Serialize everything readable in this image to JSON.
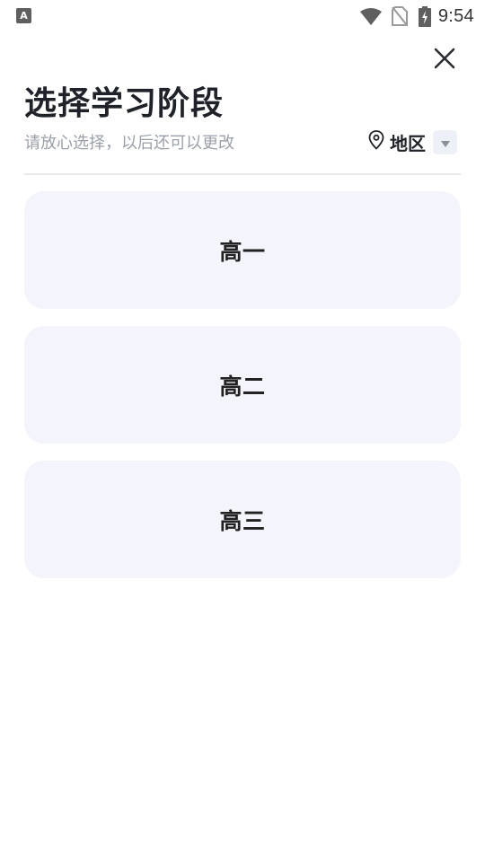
{
  "status_bar": {
    "app_icon_letter": "A",
    "time": "9:54",
    "icons": [
      "wifi-icon",
      "no-sim-icon",
      "battery-charging-icon"
    ]
  },
  "header": {
    "close_icon": "close-icon",
    "title": "选择学习阶段",
    "subtitle": "请放心选择，以后还可以更改"
  },
  "region": {
    "icon": "location-pin-icon",
    "label": "地区",
    "dropdown_icon": "caret-down-icon"
  },
  "grades": [
    {
      "label": "高一"
    },
    {
      "label": "高二"
    },
    {
      "label": "高三"
    }
  ],
  "colors": {
    "card_background": "#f3f4fc",
    "title_text": "#1f2329",
    "subtitle_text": "#9aa0aa",
    "divider": "#e7e8ec"
  }
}
